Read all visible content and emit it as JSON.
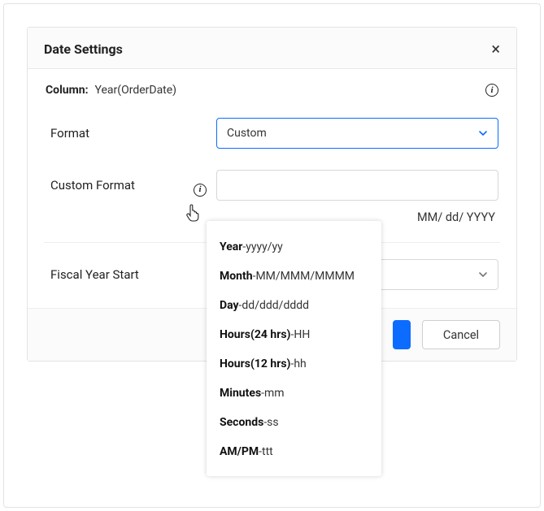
{
  "header": {
    "title": "Date Settings"
  },
  "column": {
    "label": "Column:",
    "value": "Year(OrderDate)"
  },
  "format": {
    "label": "Format",
    "selected": "Custom"
  },
  "customFormat": {
    "label": "Custom Format",
    "value": "",
    "hint": "MM/ dd/ YYYY"
  },
  "fiscal": {
    "label": "Fiscal Year Start",
    "selected": ""
  },
  "footer": {
    "cancel": "Cancel"
  },
  "tooltip": {
    "items": [
      {
        "bold": "Year",
        "rest": "-yyyy/yy"
      },
      {
        "bold": "Month",
        "rest": "-MM/MMM/MMMM"
      },
      {
        "bold": "Day",
        "rest": "-dd/ddd/dddd"
      },
      {
        "bold": "Hours(24 hrs)",
        "rest": "-HH"
      },
      {
        "bold": "Hours(12 hrs)",
        "rest": "-hh"
      },
      {
        "bold": "Minutes",
        "rest": "-mm"
      },
      {
        "bold": "Seconds",
        "rest": "-ss"
      },
      {
        "bold": "AM/PM",
        "rest": "-ttt"
      }
    ]
  }
}
